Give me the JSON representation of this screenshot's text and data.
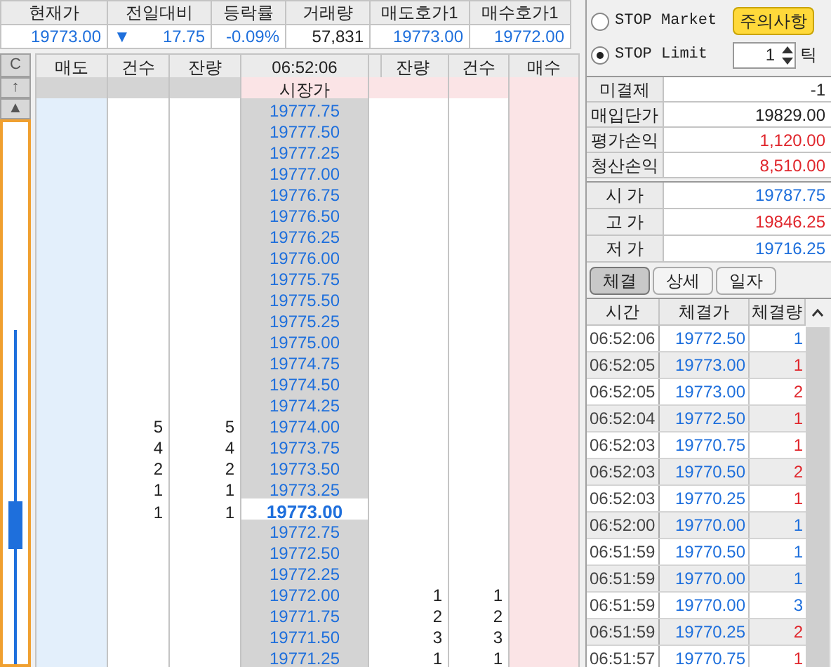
{
  "quote_header": [
    {
      "label": "현재가",
      "value": "19773.00",
      "color": "#1e6fdc"
    },
    {
      "label": "전일대비",
      "value": "17.75",
      "arrow": "▼",
      "color": "#1e6fdc"
    },
    {
      "label": "등락률",
      "value": "-0.09%",
      "color": "#1e6fdc"
    },
    {
      "label": "거래량",
      "value": "57,831",
      "color": "#222222"
    },
    {
      "label": "매도호가1",
      "value": "19773.00",
      "color": "#1e6fdc"
    },
    {
      "label": "매수호가1",
      "value": "19772.00",
      "color": "#1e6fdc"
    }
  ],
  "order_book": {
    "side_buttons": [
      "C",
      "↑",
      "▲"
    ],
    "columns": [
      "매도",
      "건수",
      "잔량",
      "06:52:06",
      "잔량",
      "건수",
      "매수"
    ],
    "market_row": "시장가",
    "rows": [
      {
        "price": "19777.75",
        "current": false
      },
      {
        "price": "19777.50",
        "current": false
      },
      {
        "price": "19777.25",
        "current": false
      },
      {
        "price": "19777.00",
        "current": false
      },
      {
        "price": "19776.75",
        "current": false
      },
      {
        "price": "19776.50",
        "current": false
      },
      {
        "price": "19776.25",
        "current": false
      },
      {
        "price": "19776.00",
        "current": false
      },
      {
        "price": "19775.75",
        "current": false
      },
      {
        "price": "19775.50",
        "current": false
      },
      {
        "price": "19775.25",
        "current": false
      },
      {
        "price": "19775.00",
        "current": false
      },
      {
        "price": "19774.75",
        "current": false
      },
      {
        "price": "19774.50",
        "current": false
      },
      {
        "price": "19774.25",
        "current": false
      },
      {
        "price": "19774.00",
        "sell_count": "5",
        "sell_qty": "5",
        "current": false
      },
      {
        "price": "19773.75",
        "sell_count": "4",
        "sell_qty": "4",
        "current": false
      },
      {
        "price": "19773.50",
        "sell_count": "2",
        "sell_qty": "2",
        "current": false
      },
      {
        "price": "19773.25",
        "sell_count": "1",
        "sell_qty": "1",
        "current": false
      },
      {
        "price": "19773.00",
        "sell_count": "1",
        "sell_qty": "1",
        "current": true
      },
      {
        "price": "19772.75",
        "current": false
      },
      {
        "price": "19772.50",
        "current": false
      },
      {
        "price": "19772.25",
        "current": false
      },
      {
        "price": "19772.00",
        "buy_qty": "1",
        "buy_count": "1",
        "current": false
      },
      {
        "price": "19771.75",
        "buy_qty": "2",
        "buy_count": "2",
        "current": false
      },
      {
        "price": "19771.50",
        "buy_qty": "3",
        "buy_count": "3",
        "current": false
      },
      {
        "price": "19771.25",
        "buy_qty": "1",
        "buy_count": "1",
        "current": false
      }
    ]
  },
  "stop_orders": {
    "options": [
      {
        "label": "STOP Market",
        "selected": false
      },
      {
        "label": "STOP Limit",
        "selected": true
      }
    ],
    "notice_button": "주의사항",
    "tick_value": "1",
    "tick_unit": "틱"
  },
  "position": [
    {
      "label": "미결제",
      "value": "-1",
      "color": "#222222"
    },
    {
      "label": "매입단가",
      "value": "19829.00",
      "color": "#222222"
    },
    {
      "label": "평가손익",
      "value": "1,120.00",
      "color": "#e0262c"
    },
    {
      "label": "청산손익",
      "value": "8,510.00",
      "color": "#e0262c"
    }
  ],
  "prices": [
    {
      "label": "시 가",
      "value": "19787.75",
      "color": "#1e6fdc"
    },
    {
      "label": "고 가",
      "value": "19846.25",
      "color": "#e0262c"
    },
    {
      "label": "저 가",
      "value": "19716.25",
      "color": "#1e6fdc"
    }
  ],
  "tabs": [
    {
      "label": "체결",
      "selected": true
    },
    {
      "label": "상세",
      "selected": false
    },
    {
      "label": "일자",
      "selected": false
    }
  ],
  "trades": {
    "columns": [
      "시간",
      "체결가",
      "체결량"
    ],
    "rows": [
      {
        "time": "06:52:06",
        "price": "19772.50",
        "qty": "1",
        "color": "#1e6fdc"
      },
      {
        "time": "06:52:05",
        "price": "19773.00",
        "qty": "1",
        "color": "#e0262c"
      },
      {
        "time": "06:52:05",
        "price": "19773.00",
        "qty": "2",
        "color": "#e0262c"
      },
      {
        "time": "06:52:04",
        "price": "19772.50",
        "qty": "1",
        "color": "#e0262c"
      },
      {
        "time": "06:52:03",
        "price": "19770.75",
        "qty": "1",
        "color": "#e0262c"
      },
      {
        "time": "06:52:03",
        "price": "19770.50",
        "qty": "2",
        "color": "#e0262c"
      },
      {
        "time": "06:52:03",
        "price": "19770.25",
        "qty": "1",
        "color": "#e0262c"
      },
      {
        "time": "06:52:00",
        "price": "19770.00",
        "qty": "1",
        "color": "#1e6fdc"
      },
      {
        "time": "06:51:59",
        "price": "19770.50",
        "qty": "1",
        "color": "#1e6fdc"
      },
      {
        "time": "06:51:59",
        "price": "19770.00",
        "qty": "1",
        "color": "#1e6fdc"
      },
      {
        "time": "06:51:59",
        "price": "19770.00",
        "qty": "3",
        "color": "#1e6fdc"
      },
      {
        "time": "06:51:59",
        "price": "19770.25",
        "qty": "2",
        "color": "#e0262c"
      },
      {
        "time": "06:51:57",
        "price": "19770.75",
        "qty": "1",
        "color": "#e0262c"
      }
    ]
  }
}
